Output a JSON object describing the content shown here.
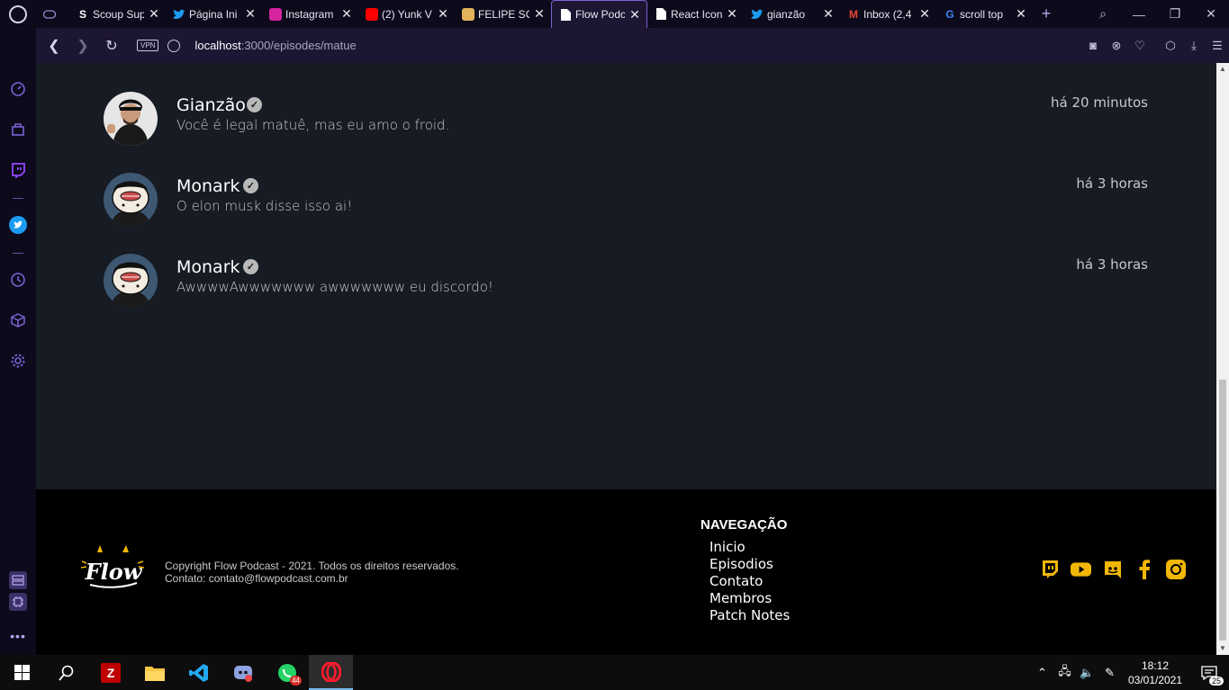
{
  "browser": {
    "tabs": [
      {
        "label": "",
        "icon": "gamepad-icon",
        "icon_color": "#9a8fd0"
      },
      {
        "label": "Scoup Sup",
        "icon": "scoup-icon",
        "icon_color": "#ffffff",
        "icon_glyph": "S"
      },
      {
        "label": "Página Ini",
        "icon": "twitter-icon",
        "icon_color": "#1d9bf0"
      },
      {
        "label": "Instagram",
        "icon": "instagram-icon",
        "icon_color": "#d6249f"
      },
      {
        "label": "(2) Yunk V",
        "icon": "youtube-icon",
        "icon_color": "#ff0000"
      },
      {
        "label": "FELIPE SO",
        "icon": "icecream-icon",
        "icon_color": "#e2b35b"
      },
      {
        "label": "Flow Podc",
        "icon": "document-icon",
        "icon_color": "#ffffff",
        "active": true
      },
      {
        "label": "React Icon",
        "icon": "document-icon",
        "icon_color": "#ffffff"
      },
      {
        "label": "gianzão",
        "icon": "twitter-icon",
        "icon_color": "#1d9bf0"
      },
      {
        "label": "Inbox (2,4",
        "icon": "gmail-icon",
        "icon_color": "#ea4335",
        "icon_glyph": "M"
      },
      {
        "label": "scroll top",
        "icon": "google-icon",
        "icon_color": "#4285f4",
        "icon_glyph": "G"
      }
    ],
    "url_host": "localhost",
    "url_path": ":3000/episodes/matue",
    "vpn_label": "VPN"
  },
  "comments": [
    {
      "name": "Gianzão",
      "text": "Você é legal matuê, mas eu amo o froid.",
      "time": "há 20 minutos"
    },
    {
      "name": "Monark",
      "text": "O elon musk disse isso ai!",
      "time": "há 3 horas"
    },
    {
      "name": "Monark",
      "text": "AwwwwAwwwwwww awwwwwww eu discordo!",
      "time": "há 3 horas"
    }
  ],
  "footer": {
    "copyright": "Copyright Flow Podcast - 2021. Todos os direitos reservados.",
    "contact": "Contato: contato@flowpodcast.com.br",
    "nav_title": "NAVEGAÇÃO",
    "nav_items": [
      "Inicio",
      "Episodios",
      "Contato",
      "Membros",
      "Patch Notes"
    ],
    "logo_text": "Flow",
    "accent": "#f2b705"
  },
  "taskbar": {
    "time": "18:12",
    "date": "03/01/2021",
    "whatsapp_badge": "44",
    "notifications": "25"
  }
}
